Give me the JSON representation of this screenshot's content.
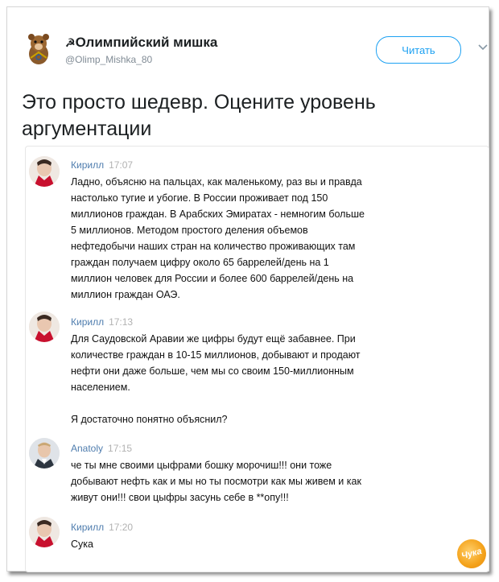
{
  "account": {
    "name": "Олимпийский мишка",
    "handle": "@Olimp_Mishka_80"
  },
  "follow_label": "Читать",
  "tweet_text": "Это просто шедевр. Оцените уровень аргументации",
  "messages": [
    {
      "author": "Кирилл",
      "time": "17:07",
      "text": "Ладно, объясню на пальцах, как маленькому, раз вы и правда\nнастолько тугие и убогие. В России проживает под 150\nмиллионов граждан. В Арабских Эмиратах - немногим больше\n5 миллионов. Методом простого деления объемов\nнефтедобычи наших стран на количество проживающих там\nграждан получаем цифру около 65 баррелей/день на 1\nмиллион человек для России и более 600 баррелей/день на\nмиллион граждан ОАЭ."
    },
    {
      "author": "Кирилл",
      "time": "17:13",
      "text": "Для Саудовской Аравии же цифры будут ещё забавнее. При\nколичестве граждан в 10-15 миллионов, добывают и продают\nнефти они даже больше, чем мы со своим 150-миллионным\nнаселением.\n\nЯ достаточно понятно объяснил?"
    },
    {
      "author": "Anatoly",
      "time": "17:15",
      "text": "че ты мне своими цыфрами бошку морочиш!!! они тоже\nдобывают нефть как и мы но ты посмотри как мы живем и как\nживут они!!! свои цыфры засунь себе в **опу!!!"
    },
    {
      "author": "Кирилл",
      "time": "17:20",
      "text": "Сука"
    }
  ],
  "watermark": "Чука",
  "colors": {
    "follow_blue": "#1da1f2",
    "author_blue": "#4f7dae",
    "time_gray": "#b2b2b2"
  },
  "icons": [
    "bear-mascot-avatar",
    "chevron-down-icon",
    "user-avatar",
    "watermark-logo"
  ]
}
